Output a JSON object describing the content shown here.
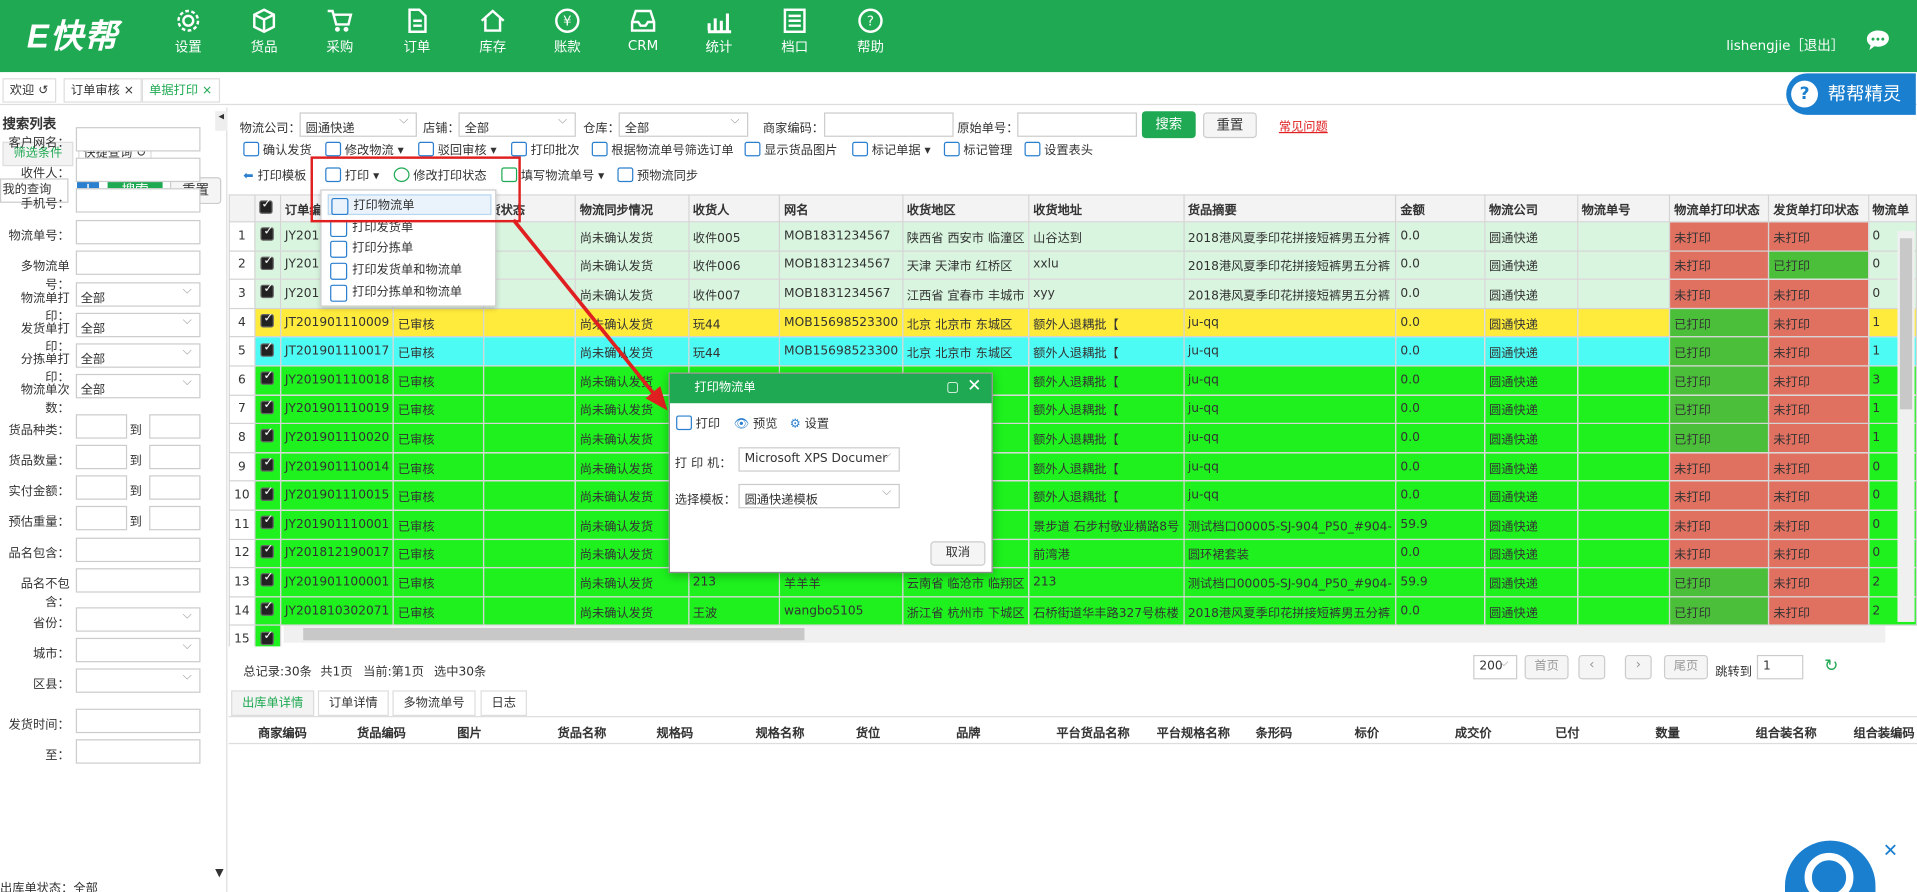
{
  "app": {
    "logo": "E快帮",
    "user": "lishengjie［退出］"
  },
  "nav": [
    {
      "label": "设置",
      "icon": "gear-icon"
    },
    {
      "label": "货品",
      "icon": "box-icon"
    },
    {
      "label": "采购",
      "icon": "cart-icon"
    },
    {
      "label": "订单",
      "icon": "document-icon"
    },
    {
      "label": "库存",
      "icon": "home-icon"
    },
    {
      "label": "账款",
      "icon": "yen-icon"
    },
    {
      "label": "CRM",
      "icon": "inbox-icon"
    },
    {
      "label": "统计",
      "icon": "chart-icon"
    },
    {
      "label": "档口",
      "icon": "list-icon"
    },
    {
      "label": "帮助",
      "icon": "help-icon"
    }
  ],
  "tabs": [
    {
      "label": "欢迎 ↺"
    },
    {
      "label": "订单审核 ×"
    },
    {
      "label": "单据打印 ×"
    }
  ],
  "help_badge": "帮帮精灵",
  "sidebar": {
    "title": "搜索列表",
    "tab_filter": "筛选条件",
    "tab_quick": "快捷查询 ↺",
    "my_query": "我的查询",
    "search": "搜索",
    "reset": "重置",
    "fields": [
      "客户网名：",
      "收件人：",
      "手机号：",
      "物流单号：",
      "多物流单号："
    ],
    "selects": [
      {
        "label": "物流单打印：",
        "value": "全部"
      },
      {
        "label": "发货单打印：",
        "value": "全部"
      },
      {
        "label": "分拣单打印：",
        "value": "全部"
      },
      {
        "label": "物流单次数：",
        "value": "全部"
      }
    ],
    "ranges": [
      "货品种类：",
      "货品数量：",
      "实付金额：",
      "预估重量："
    ],
    "range_to": "到",
    "fields2": [
      "品名包含：",
      "品名不包含："
    ],
    "region": [
      "省份：",
      "城市：",
      "区县："
    ],
    "dates": [
      "发货时间：",
      "至："
    ],
    "last": "出库单状态：全部"
  },
  "filter": {
    "logistics_label": "物流公司：",
    "logistics": "圆通快递",
    "shop_label": "店铺：",
    "shop": "全部",
    "warehouse_label": "仓库：",
    "warehouse": "全部",
    "merchant_label": "商家编码：",
    "orig_label": "原始单号：",
    "search": "搜索",
    "reset": "重置",
    "faq": "常见问题"
  },
  "toolbar1": [
    "确认发货",
    "修改物流 ▾",
    "驳回审核 ▾",
    "打印批次",
    "根据物流单号筛选订单",
    "显示货品图片",
    "标记单据 ▾",
    "标记管理",
    "设置表头"
  ],
  "toolbar2": {
    "template": "打印模板",
    "print": "打印 ▾",
    "modify": "修改打印状态",
    "fill": "填写物流单号 ▾",
    "presync": "预物流同步"
  },
  "print_menu": [
    "打印物流单",
    "打印发货单",
    "打印分拣单",
    "打印发货单和物流单",
    "打印分拣单和物流单"
  ],
  "columns": [
    "订单编号",
    "订单状态",
    "货状态",
    "物流同步情况",
    "收货人",
    "网名",
    "收货地区",
    "收货地址",
    "货品摘要",
    "金额",
    "物流公司",
    "物流单号",
    "物流单打印状态",
    "发货单打印状态",
    "物流单"
  ],
  "rows": [
    {
      "n": "1",
      "id": "JY201",
      "status": "",
      "sync": "尚未确认发货",
      "recv": "收件005",
      "nick": "MOB1831234567",
      "area": "陕西省 西安市 临潼区",
      "addr": "山谷达到",
      "goods": "2018港风夏季印花拼接短裤男五分裤",
      "amt": "0.0",
      "co": "圆通快递",
      "lp": "未打印",
      "dp": "未打印",
      "cnt": "0",
      "color": "#d9f5df"
    },
    {
      "n": "2",
      "id": "JY201",
      "status": "",
      "sync": "尚未确认发货",
      "recv": "收件006",
      "nick": "MOB1831234567",
      "area": "天津 天津市 红桥区",
      "addr": "xxlu",
      "goods": "2018港风夏季印花拼接短裤男五分裤",
      "amt": "0.0",
      "co": "圆通快递",
      "lp": "未打印",
      "dp": "已打印",
      "cnt": "0",
      "color": "#d9f5df"
    },
    {
      "n": "3",
      "id": "JY201",
      "status": "",
      "sync": "尚未确认发货",
      "recv": "收件007",
      "nick": "MOB1831234567",
      "area": "江西省 宜春市 丰城市",
      "addr": "xyy",
      "goods": "2018港风夏季印花拼接短裤男五分裤",
      "amt": "0.0",
      "co": "圆通快递",
      "lp": "未打印",
      "dp": "未打印",
      "cnt": "0",
      "color": "#d9f5df"
    },
    {
      "n": "4",
      "id": "JT201901110009",
      "status": "已审核",
      "sync": "尚未确认发货",
      "recv": "玩44",
      "nick": "MOB15698523300",
      "area": "北京 北京市 东城区",
      "addr": "额外人退耦批【",
      "goods": "ju-qq",
      "amt": "0.0",
      "co": "圆通快递",
      "lp": "已打印",
      "dp": "未打印",
      "cnt": "1",
      "color": "#ffeb3b"
    },
    {
      "n": "5",
      "id": "JT201901110017",
      "status": "已审核",
      "sync": "尚未确认发货",
      "recv": "玩44",
      "nick": "MOB15698523300",
      "area": "北京 北京市 东城区",
      "addr": "额外人退耦批【",
      "goods": "ju-qq",
      "amt": "0.0",
      "co": "圆通快递",
      "lp": "已打印",
      "dp": "未打印",
      "cnt": "1",
      "color": "#4dfbf5"
    },
    {
      "n": "6",
      "id": "JY201901110018",
      "status": "已审核",
      "sync": "尚未确认发货",
      "recv": "",
      "nick": "",
      "area": "区",
      "addr": "额外人退耦批【",
      "goods": "ju-qq",
      "amt": "0.0",
      "co": "圆通快递",
      "lp": "已打印",
      "dp": "未打印",
      "cnt": "3",
      "color": "#1ef11e"
    },
    {
      "n": "7",
      "id": "JY201901110019",
      "status": "已审核",
      "sync": "尚未确认发货",
      "recv": "",
      "nick": "",
      "area": "区",
      "addr": "额外人退耦批【",
      "goods": "ju-qq",
      "amt": "0.0",
      "co": "圆通快递",
      "lp": "已打印",
      "dp": "未打印",
      "cnt": "1",
      "color": "#1ef11e"
    },
    {
      "n": "8",
      "id": "JY201901110020",
      "status": "已审核",
      "sync": "尚未确认发货",
      "recv": "",
      "nick": "",
      "area": "区",
      "addr": "额外人退耦批【",
      "goods": "ju-qq",
      "amt": "0.0",
      "co": "圆通快递",
      "lp": "已打印",
      "dp": "未打印",
      "cnt": "1",
      "color": "#1ef11e"
    },
    {
      "n": "9",
      "id": "JY201901110014",
      "status": "已审核",
      "sync": "尚未确认发货",
      "recv": "",
      "nick": "",
      "area": "区",
      "addr": "额外人退耦批【",
      "goods": "ju-qq",
      "amt": "0.0",
      "co": "圆通快递",
      "lp": "未打印",
      "dp": "未打印",
      "cnt": "0",
      "color": "#1ef11e"
    },
    {
      "n": "10",
      "id": "JY201901110015",
      "status": "已审核",
      "sync": "尚未确认发货",
      "recv": "",
      "nick": "",
      "area": "区",
      "addr": "额外人退耦批【",
      "goods": "ju-qq",
      "amt": "0.0",
      "co": "圆通快递",
      "lp": "未打印",
      "dp": "未打印",
      "cnt": "0",
      "color": "#1ef11e"
    },
    {
      "n": "11",
      "id": "JY201901110001",
      "status": "已审核",
      "sync": "尚未确认发货",
      "recv": "",
      "nick": "",
      "area": "",
      "addr": "景步道 石步村敬业横路8号",
      "goods": "测试档口00005-SJ-904_P50_#904-",
      "amt": "59.9",
      "co": "圆通快递",
      "lp": "未打印",
      "dp": "未打印",
      "cnt": "0",
      "color": "#1ef11e"
    },
    {
      "n": "12",
      "id": "JY201812190017",
      "status": "已审核",
      "sync": "尚未确认发货",
      "recv": "",
      "nick": "",
      "area": "岛区",
      "addr": "前湾港",
      "goods": "圆环裙套装",
      "amt": "0.0",
      "co": "圆通快递",
      "lp": "未打印",
      "dp": "未打印",
      "cnt": "0",
      "color": "#1ef11e"
    },
    {
      "n": "13",
      "id": "JY201901100001",
      "status": "已审核",
      "sync": "尚未确认发货",
      "recv": "213",
      "nick": "羊羊羊",
      "area": "云南省 临沧市 临翔区",
      "addr": "213",
      "goods": "测试档口00005-SJ-904_P50_#904-",
      "amt": "59.9",
      "co": "圆通快递",
      "lp": "已打印",
      "dp": "未打印",
      "cnt": "2",
      "color": "#1ef11e"
    },
    {
      "n": "14",
      "id": "JY201810302071",
      "status": "已审核",
      "sync": "尚未确认发货",
      "recv": "王波",
      "nick": "wangbo5105",
      "area": "浙江省 杭州市 下城区",
      "addr": "石桥街道华丰路327号栋楼",
      "goods": "2018港风夏季印花拼接短裤男五分裤",
      "amt": "0.0",
      "co": "圆通快递",
      "lp": "已打印",
      "dp": "未打印",
      "cnt": "2",
      "color": "#1ef11e"
    }
  ],
  "row15": "15",
  "dialog": {
    "title": "打印物流单",
    "print": "打印",
    "preview": "预览",
    "settings": "设置",
    "printer_label": "打 印 机：",
    "printer": "Microsoft XPS Documer",
    "template_label": "选择模板：",
    "template": "圆通快递模板",
    "cancel": "取消"
  },
  "pager": {
    "total": "总记录:30条",
    "pages": "共1页",
    "current": "当前:第1页",
    "selected": "选中30条",
    "size": "200",
    "first": "首页",
    "last": "尾页",
    "jump": "跳转到",
    "page": "1"
  },
  "bottom_tabs": [
    "出库单详情",
    "订单详情",
    "多物流单号",
    "日志"
  ],
  "bottom_cols": [
    "商家编码",
    "货品编码",
    "图片",
    "货品名称",
    "规格码",
    "规格名称",
    "货位",
    "品牌",
    "平台货品名称",
    "平台规格名称",
    "条形码",
    "标价",
    "成交价",
    "已付",
    "数量",
    "组合装名称",
    "组合装编码"
  ],
  "colors": {
    "green": "#1fa952",
    "red_status": "#e07060",
    "green_status": "#4bbf3a",
    "blue": "#2a7fcf"
  }
}
